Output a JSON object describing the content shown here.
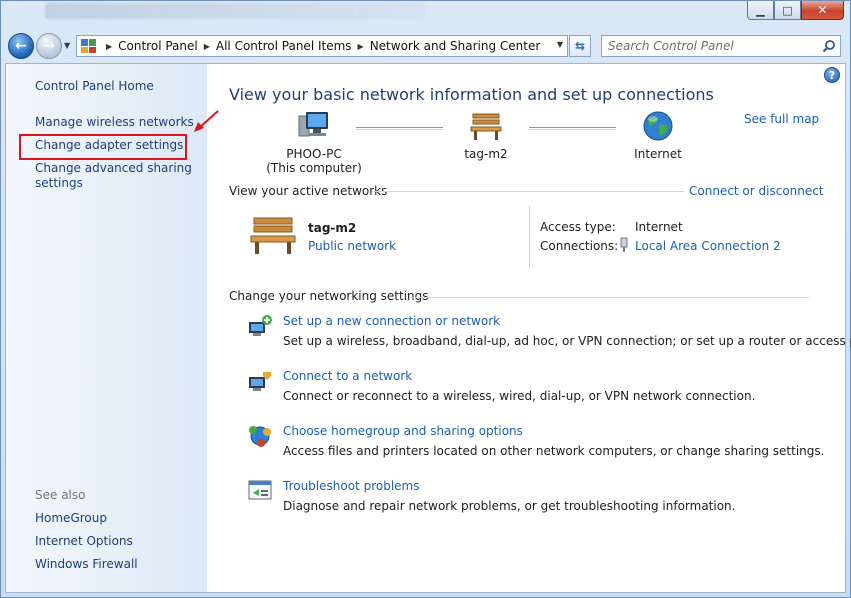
{
  "window": {
    "controls": {
      "minimize": "▁",
      "maximize": "□",
      "close": "✕"
    }
  },
  "address_bar": {
    "breadcrumbs": [
      "Control Panel",
      "All Control Panel Items",
      "Network and Sharing Center"
    ],
    "search_placeholder": "Search Control Panel"
  },
  "sidebar": {
    "home": "Control Panel Home",
    "links": [
      "Manage wireless networks",
      "Change adapter settings",
      "Change advanced sharing settings"
    ],
    "see_also_label": "See also",
    "see_also": [
      "HomeGroup",
      "Internet Options",
      "Windows Firewall"
    ]
  },
  "main": {
    "title": "View your basic network information and set up connections",
    "see_full_map": "See full map",
    "map": {
      "computer_name": "PHOO-PC",
      "computer_sub": "(This computer)",
      "network": "tag-m2",
      "internet": "Internet"
    },
    "active_networks": {
      "heading": "View your active networks",
      "action": "Connect or disconnect",
      "network_name": "tag-m2",
      "network_type": "Public network",
      "access_type_label": "Access type:",
      "access_type_value": "Internet",
      "connections_label": "Connections:",
      "connections_value": "Local Area Connection 2"
    },
    "settings": {
      "heading": "Change your networking settings",
      "tasks": [
        {
          "title": "Set up a new connection or network",
          "desc": "Set up a wireless, broadband, dial-up, ad hoc, or VPN connection; or set up a router or access point."
        },
        {
          "title": "Connect to a network",
          "desc": "Connect or reconnect to a wireless, wired, dial-up, or VPN network connection."
        },
        {
          "title": "Choose homegroup and sharing options",
          "desc": "Access files and printers located on other network computers, or change sharing settings."
        },
        {
          "title": "Troubleshoot problems",
          "desc": "Diagnose and repair network problems, or get troubleshooting information."
        }
      ]
    }
  },
  "colors": {
    "link": "#1b5fb4",
    "highlight": "#e0141d",
    "title": "#1e3f7a"
  }
}
